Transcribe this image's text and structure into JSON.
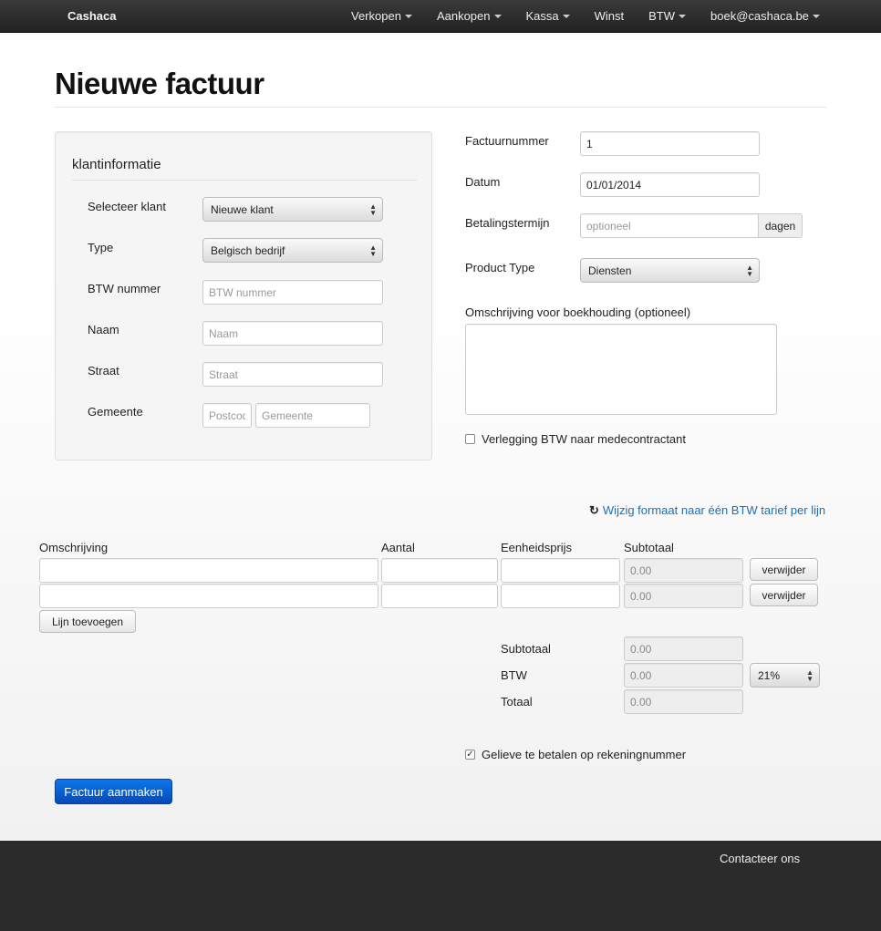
{
  "navbar": {
    "brand": "Cashaca",
    "items": [
      "Verkopen",
      "Aankopen",
      "Kassa",
      "Winst",
      "BTW",
      "boek@cashaca.be"
    ]
  },
  "page_title": "Nieuwe factuur",
  "client": {
    "title": "klantinformatie",
    "select_client_label": "Selecteer klant",
    "select_client_value": "Nieuwe klant",
    "type_label": "Type",
    "type_value": "Belgisch bedrijf",
    "vat_label": "BTW nummer",
    "vat_placeholder": "BTW nummer",
    "name_label": "Naam",
    "name_placeholder": "Naam",
    "street_label": "Straat",
    "street_placeholder": "Straat",
    "city_label": "Gemeente",
    "postcode_placeholder": "Postcode",
    "city_placeholder": "Gemeente"
  },
  "invoice": {
    "number_label": "Factuurnummer",
    "number_value": "1",
    "date_label": "Datum",
    "date_value": "01/01/2014",
    "term_label": "Betalingstermijn",
    "term_placeholder": "optioneel",
    "term_addon": "dagen",
    "product_type_label": "Product Type",
    "product_type_value": "Diensten",
    "description_label": "Omschrijving voor boekhouding (optioneel)",
    "reverse_charge_label": "Verlegging BTW naar medecontractant"
  },
  "format_link": "Wijzig formaat naar één BTW tarief per lijn",
  "lines": {
    "headers": [
      "Omschrijving",
      "Aantal",
      "Eenheidsprijs",
      "Subtotaal"
    ],
    "rows": [
      {
        "subtotal": "0.00",
        "remove_label": "verwijder"
      },
      {
        "subtotal": "0.00",
        "remove_label": "verwijder"
      }
    ],
    "add_line_label": "Lijn toevoegen"
  },
  "totals": {
    "subtotal_label": "Subtotaal",
    "subtotal_value": "0.00",
    "vat_label": "BTW",
    "vat_value": "0.00",
    "vat_rate": "21%",
    "total_label": "Totaal",
    "total_value": "0.00"
  },
  "pay_account_label": "Gelieve te betalen op rekeningnummer",
  "create_button": "Factuur aanmaken",
  "footer": {
    "contact": "Contacteer ons"
  }
}
